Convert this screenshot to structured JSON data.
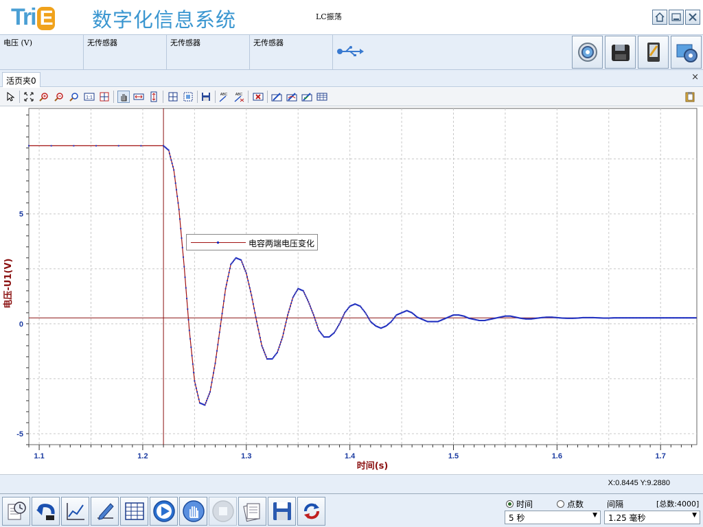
{
  "title_bar": {
    "logo_text_t": "Tri",
    "logo_text_e": "E",
    "app_title": "数字化信息系统",
    "experiment_name": "LC振荡",
    "window_buttons": [
      "home-icon",
      "minimize-icon",
      "close-icon"
    ]
  },
  "sensors": [
    {
      "label": "电压 (V)"
    },
    {
      "label": "无传感器"
    },
    {
      "label": "无传感器"
    },
    {
      "label": "无传感器"
    }
  ],
  "tab": {
    "label": "活页夹0",
    "close": "×"
  },
  "toolbar": {
    "icons": [
      "pointer-icon",
      "fit-icon",
      "zoom-in-icon",
      "zoom-out-icon",
      "zoom-search-icon",
      "one-to-one-icon",
      "grid-icon",
      "pan-icon",
      "h-scale-icon",
      "v-scale-icon",
      "cross-grid-icon",
      "select-region-icon",
      "save-icon",
      "label-add-icon",
      "label-remove-icon",
      "delete-icon",
      "draw-icon",
      "draw-fit-icon",
      "draw-check-icon",
      "table-icon"
    ],
    "label_abc": "ABC"
  },
  "chart_data": {
    "type": "line",
    "title": "",
    "xlabel": "时间(s)",
    "ylabel": "电压-U1(V)",
    "xlim": [
      1.09,
      1.735
    ],
    "ylim": [
      -5.5,
      9.8
    ],
    "x_ticks": [
      1.1,
      1.2,
      1.3,
      1.4,
      1.5,
      1.6,
      1.7
    ],
    "y_ticks": [
      5,
      0,
      -5
    ],
    "x_tick_labels": [
      "1.1",
      "1.2",
      "1.3",
      "1.4",
      "1.5",
      "1.6",
      "1.7"
    ],
    "y_tick_labels": [
      "5",
      "0",
      "-5"
    ],
    "grid": true,
    "legend": {
      "position": "top-left",
      "entries": [
        "电容两端电压变化"
      ]
    },
    "series": [
      {
        "name": "电容两端电压变化",
        "color_line": "#a01010",
        "color_points": "#2030c0",
        "x": [
          1.09,
          1.22,
          1.225,
          1.23,
          1.235,
          1.24,
          1.245,
          1.25,
          1.255,
          1.26,
          1.265,
          1.27,
          1.275,
          1.28,
          1.285,
          1.29,
          1.295,
          1.3,
          1.305,
          1.31,
          1.315,
          1.32,
          1.325,
          1.33,
          1.335,
          1.34,
          1.345,
          1.35,
          1.355,
          1.36,
          1.365,
          1.37,
          1.375,
          1.38,
          1.385,
          1.39,
          1.395,
          1.4,
          1.405,
          1.41,
          1.415,
          1.42,
          1.425,
          1.43,
          1.435,
          1.44,
          1.445,
          1.45,
          1.455,
          1.46,
          1.465,
          1.47,
          1.475,
          1.48,
          1.485,
          1.49,
          1.495,
          1.5,
          1.505,
          1.51,
          1.515,
          1.52,
          1.525,
          1.53,
          1.535,
          1.54,
          1.545,
          1.55,
          1.555,
          1.56,
          1.565,
          1.57,
          1.575,
          1.58,
          1.585,
          1.59,
          1.595,
          1.6,
          1.605,
          1.61,
          1.615,
          1.62,
          1.625,
          1.63,
          1.635,
          1.64,
          1.645,
          1.65,
          1.655,
          1.66,
          1.665,
          1.67,
          1.675,
          1.68,
          1.685,
          1.69,
          1.695,
          1.7,
          1.705,
          1.71,
          1.715,
          1.72,
          1.725,
          1.73,
          1.735
        ],
        "y": [
          8.1,
          8.1,
          7.9,
          7.0,
          5.2,
          2.6,
          -0.3,
          -2.6,
          -3.6,
          -3.7,
          -3.1,
          -1.8,
          -0.1,
          1.6,
          2.7,
          3.0,
          2.9,
          2.3,
          1.3,
          0.1,
          -1.0,
          -1.6,
          -1.6,
          -1.3,
          -0.6,
          0.4,
          1.2,
          1.6,
          1.5,
          1.0,
          0.4,
          -0.3,
          -0.6,
          -0.6,
          -0.4,
          0.0,
          0.5,
          0.8,
          0.9,
          0.8,
          0.5,
          0.1,
          -0.1,
          -0.2,
          -0.1,
          0.1,
          0.4,
          0.5,
          0.6,
          0.5,
          0.3,
          0.2,
          0.1,
          0.1,
          0.1,
          0.2,
          0.3,
          0.4,
          0.4,
          0.35,
          0.25,
          0.2,
          0.15,
          0.15,
          0.2,
          0.25,
          0.3,
          0.35,
          0.35,
          0.3,
          0.25,
          0.22,
          0.22,
          0.25,
          0.28,
          0.3,
          0.3,
          0.28,
          0.26,
          0.25,
          0.25,
          0.26,
          0.28,
          0.28,
          0.28,
          0.27,
          0.26,
          0.26,
          0.27,
          0.27,
          0.27,
          0.27,
          0.27,
          0.27,
          0.27,
          0.27,
          0.27,
          0.27,
          0.27,
          0.27,
          0.27,
          0.27,
          0.27,
          0.27,
          0.27
        ]
      }
    ],
    "cursor_x": 1.22,
    "cursor_y": 0.27
  },
  "status": {
    "coordinates": "X:0.8445 Y:9.2880"
  },
  "bottom": {
    "buttons": [
      "clock-icon",
      "undo-icon",
      "chart-icon",
      "edit-icon",
      "table-icon",
      "play-icon",
      "hand-icon",
      "stop-icon",
      "pages-icon",
      "save-icon",
      "refresh-icon"
    ],
    "radio_time": "时间",
    "radio_points": "点数",
    "time_selected": true,
    "interval_label": "间隔",
    "total_label": "[总数:4000]",
    "duration_value": "5 秒",
    "interval_value": "1.25 毫秒"
  }
}
